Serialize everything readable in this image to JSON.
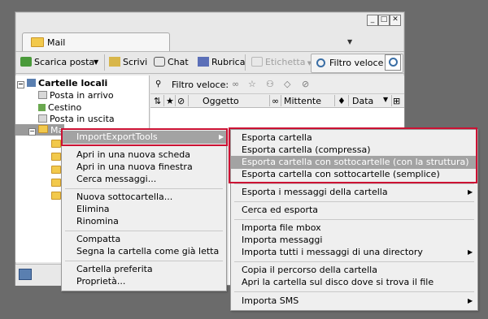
{
  "window": {
    "tab_title": "Mail",
    "controls": [
      "_",
      "□",
      "✕"
    ]
  },
  "toolbar": {
    "scarica": "Scarica posta",
    "scrivi": "Scrivi",
    "chat": "Chat",
    "rubrica": "Rubrica",
    "etichetta": "Etichetta",
    "filtro": "Filtro veloce"
  },
  "folders": {
    "root": "Cartelle locali",
    "items": [
      "Posta in arrivo",
      "Cestino",
      "Posta in uscita",
      "Mail"
    ]
  },
  "filterbar": {
    "label": "Filtro veloce:"
  },
  "columns": {
    "oggetto": "Oggetto",
    "mittente": "Mittente",
    "data": "Data"
  },
  "context_menu": {
    "highlighted": "ImportExportTools",
    "items": [
      "Apri in una nuova scheda",
      "Apri in una nuova finestra",
      "Cerca messaggi...",
      "Nuova sottocartella...",
      "Elimina",
      "Rinomina",
      "Compatta",
      "Segna la cartella come già letta",
      "Cartella preferita",
      "Proprietà..."
    ]
  },
  "submenu": {
    "export_items": [
      "Esporta cartella",
      "Esporta cartella (compressa)",
      "Esporta cartella con sottocartelle (con la struttura)",
      "Esporta cartella con sottocartelle (semplice)"
    ],
    "highlighted_index": 2,
    "other_items": [
      "Esporta i messaggi della cartella",
      "Cerca ed esporta",
      "Importa file mbox",
      "Importa messaggi",
      "Importa tutti i messaggi di una directory",
      "Copia il percorso della cartella",
      "Apri la cartella sul disco dove si trova il file",
      "Importa SMS"
    ]
  },
  "colors": {
    "highlight": "#a3a3a3",
    "callout": "#cc1133",
    "folder": "#f2c94c"
  }
}
